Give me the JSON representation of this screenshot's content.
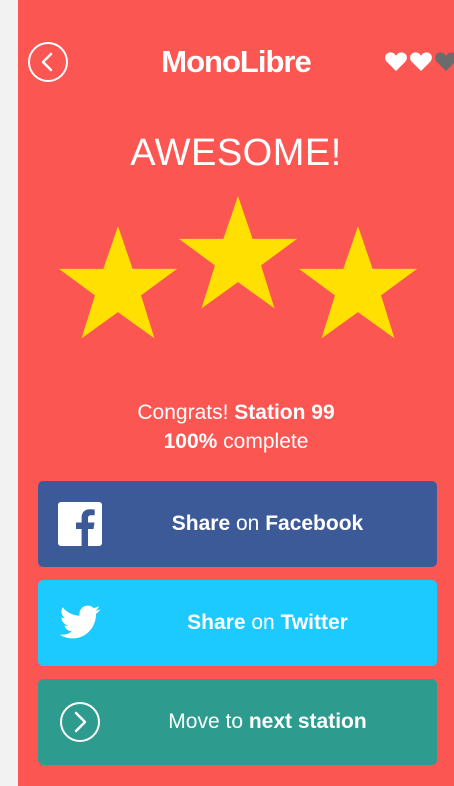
{
  "header": {
    "title": "MonoLibre",
    "back_icon": "chevron-left-circle-icon",
    "hearts": [
      {
        "icon": "heart-icon",
        "filled": true,
        "color": "#ffffff"
      },
      {
        "icon": "heart-icon",
        "filled": true,
        "color": "#ffffff"
      },
      {
        "icon": "heart-icon",
        "filled": false,
        "color": "#6b6b6b"
      }
    ]
  },
  "result": {
    "headline": "AWESOME!",
    "stars_earned": 3,
    "stars_total": 3,
    "star_color": "#ffe000"
  },
  "summary": {
    "congrats_prefix": "Congrats!",
    "station_label": "Station 99",
    "percent": "100%",
    "complete_label": "complete"
  },
  "buttons": {
    "facebook": {
      "share": "Share",
      "on": "on",
      "network": "Facebook",
      "icon": "facebook-icon",
      "color": "#3d5a98"
    },
    "twitter": {
      "share": "Share",
      "on": "on",
      "network": "Twitter",
      "icon": "twitter-bird-icon",
      "color": "#1dcaff"
    },
    "next": {
      "move": "Move to",
      "target": "next station",
      "icon": "chevron-right-circle-icon",
      "color": "#2e9b8f"
    }
  },
  "colors": {
    "background": "#fc5653",
    "text": "#ffffff"
  }
}
